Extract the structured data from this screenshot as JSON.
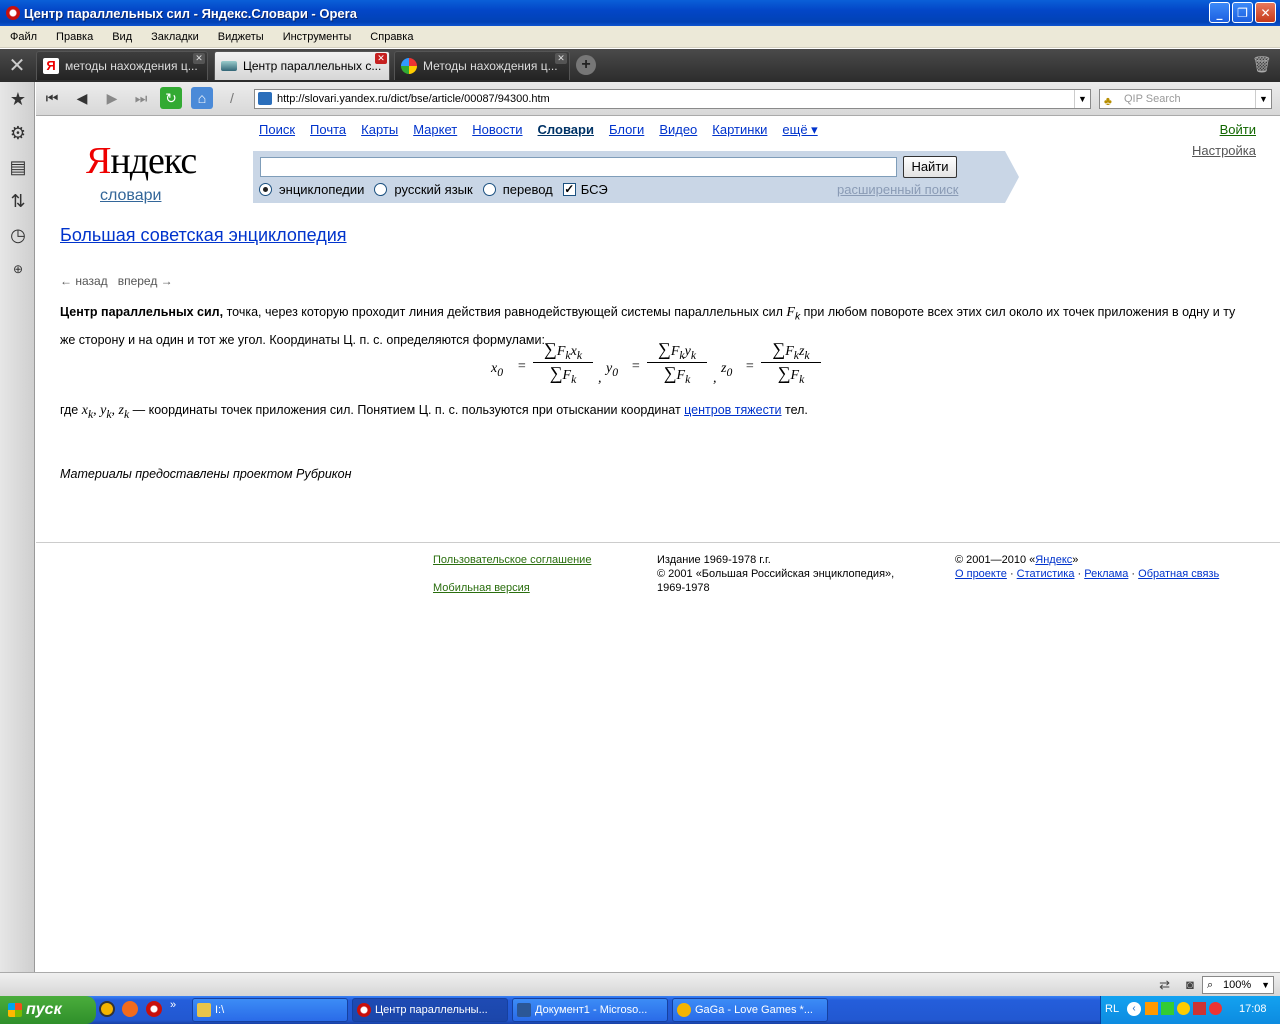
{
  "window": {
    "title": "Центр параллельных сил - Яндекс.Словари - Opera"
  },
  "menu": [
    "Файл",
    "Правка",
    "Вид",
    "Закладки",
    "Виджеты",
    "Инструменты",
    "Справка"
  ],
  "tabs": [
    {
      "label": "методы нахождения ц...",
      "icon": "yandex-icon",
      "active": false
    },
    {
      "label": "Центр параллельных с...",
      "icon": "page-icon",
      "active": true
    },
    {
      "label": "Методы нахождения ц...",
      "icon": "joomla-icon",
      "active": false
    }
  ],
  "address": {
    "url": "http://slovari.yandex.ru/dict/bse/article/00087/94300.htm",
    "search_placeholder": "QIP Search"
  },
  "header": {
    "logo_ya": "Я",
    "logo_rest": "ндекс",
    "subtitle": "словари",
    "services": [
      "Поиск",
      "Почта",
      "Карты",
      "Маркет",
      "Новости",
      "Словари",
      "Блоги",
      "Видео",
      "Картинки",
      "ещё ▾"
    ],
    "login": "Войти",
    "settings": "Настройка"
  },
  "searchform": {
    "button": "Найти",
    "options": [
      "энциклопедии",
      "русский язык",
      "перевод",
      "БСЭ"
    ],
    "advanced": "расширенный поиск"
  },
  "article": {
    "source_link": "Большая советская энциклопедия",
    "nav_back": "← назад",
    "nav_forward": "вперед →",
    "term": "Центр параллельных сил,",
    "text1": " точка, через которую проходит линия действия равнодействующей системы параллельных сил ",
    "fk": "F",
    "text2": " при любом повороте всех этих сил около их точек приложения в одну и ту же сторону и на один и тот же угол. Координаты Ц. п. с. определяются формулами:",
    "where_prefix": "где ",
    "where_vars": "x",
    "where_text": " — координаты точек приложения сил. Понятием Ц. п. с. пользуются при отыскании координат ",
    "where_link": "центров тяжести",
    "where_end": " тел.",
    "materials": "Материалы предоставлены проектом Рубрикон"
  },
  "footer": {
    "agreement": "Пользовательское соглашение",
    "mobile": "Мобильная версия",
    "edition": "Издание 1969-1978 г.г.",
    "copyright_bre": "© 2001 «Большая Российская энциклопедия»,",
    "years": "1969-1978",
    "copyright_ya_pre": "© 2001—2010 «",
    "copyright_ya_link": "Яндекс",
    "copyright_ya_post": "»",
    "links": [
      "О проекте",
      "Статистика",
      "Реклама",
      "Обратная связь"
    ]
  },
  "statusbar": {
    "zoom": "100%"
  },
  "taskbar": {
    "start": "пуск",
    "buttons": [
      {
        "label": "I:\\",
        "active": false
      },
      {
        "label": "Центр параллельны...",
        "active": true
      },
      {
        "label": "Документ1 - Microso...",
        "active": false
      },
      {
        "label": "GaGa - Love Games *...",
        "active": false
      }
    ],
    "lang": "RL",
    "clock": "17:08"
  },
  "colors": {
    "title_bar": "#0346c7",
    "yandex_red": "#e00000",
    "link": "#0033cc",
    "search_bg": "#c9d6e6",
    "taskbar": "#245edb",
    "start": "#3a9c32"
  }
}
